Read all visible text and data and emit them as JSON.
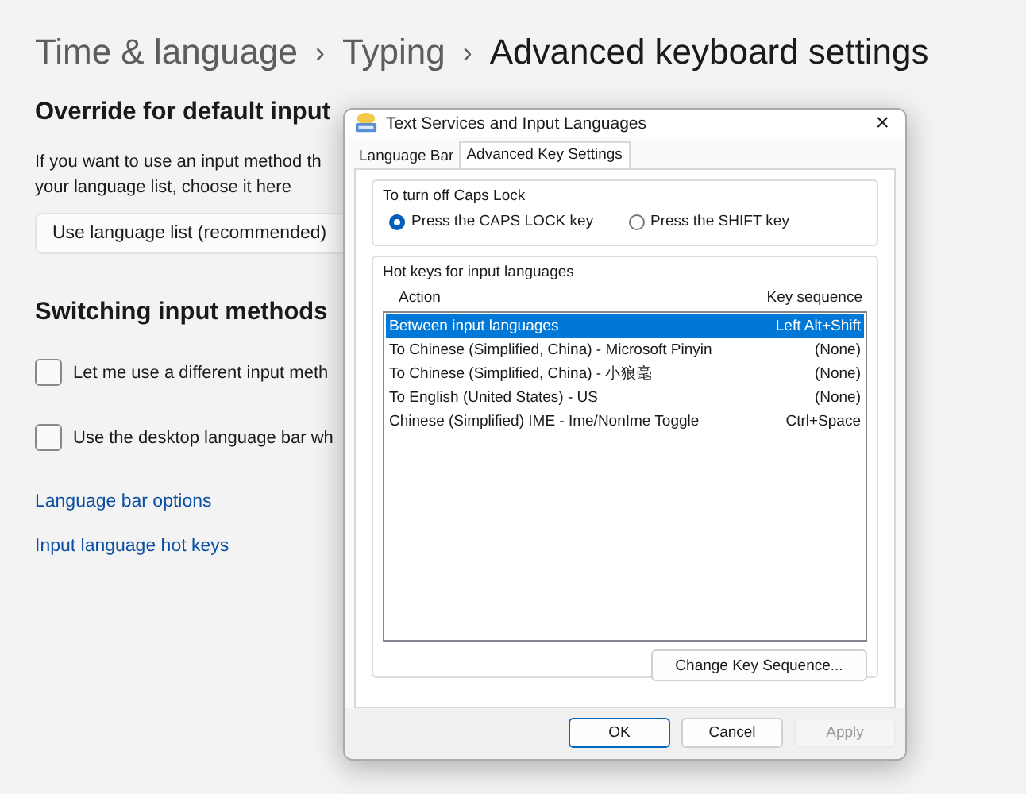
{
  "breadcrumb": [
    {
      "label": "Time & language",
      "current": false
    },
    {
      "label": "Typing",
      "current": false
    },
    {
      "label": "Advanced keyboard settings",
      "current": true
    }
  ],
  "breadcrumb_separator": "›",
  "override": {
    "heading": "Override for default input",
    "description": [
      "If you want to use an input method th",
      "your language list, choose it here"
    ],
    "dropdown_value": "Use language list (recommended)"
  },
  "switching": {
    "heading": "Switching input methods",
    "options": [
      {
        "label": "Let me use a different input meth",
        "checked": false
      },
      {
        "label": "Use the desktop language bar wh",
        "checked": false
      }
    ]
  },
  "links": [
    "Language bar options",
    "Input language hot keys"
  ],
  "dialog": {
    "title": "Text Services and Input Languages",
    "close": "×",
    "tabs": [
      {
        "label": "Language Bar",
        "selected": false
      },
      {
        "label": "Advanced Key Settings",
        "selected": true
      }
    ],
    "caps_lock": {
      "legend": "To turn off Caps Lock",
      "options": [
        {
          "label": "Press the CAPS LOCK key",
          "selected": true
        },
        {
          "label": "Press the SHIFT key",
          "selected": false
        }
      ]
    },
    "hot_keys": {
      "legend": "Hot keys for input languages",
      "columns": [
        "Action",
        "Key sequence"
      ],
      "rows": [
        {
          "action": "Between input languages",
          "key": "Left Alt+Shift",
          "selected": true
        },
        {
          "action": "To Chinese (Simplified, China) - Microsoft Pinyin",
          "key": "(None)",
          "selected": false
        },
        {
          "action": "To Chinese (Simplified, China) - 小狼毫",
          "key": "(None)",
          "selected": false
        },
        {
          "action": "To English (United States) - US",
          "key": "(None)",
          "selected": false
        },
        {
          "action": "Chinese (Simplified) IME - Ime/NonIme Toggle",
          "key": "Ctrl+Space",
          "selected": false
        }
      ],
      "change_button": "Change Key Sequence..."
    },
    "buttons": [
      {
        "label": "OK",
        "kind": "default",
        "disabled": false
      },
      {
        "label": "Cancel",
        "kind": "normal",
        "disabled": false
      },
      {
        "label": "Apply",
        "kind": "normal",
        "disabled": true
      }
    ]
  }
}
